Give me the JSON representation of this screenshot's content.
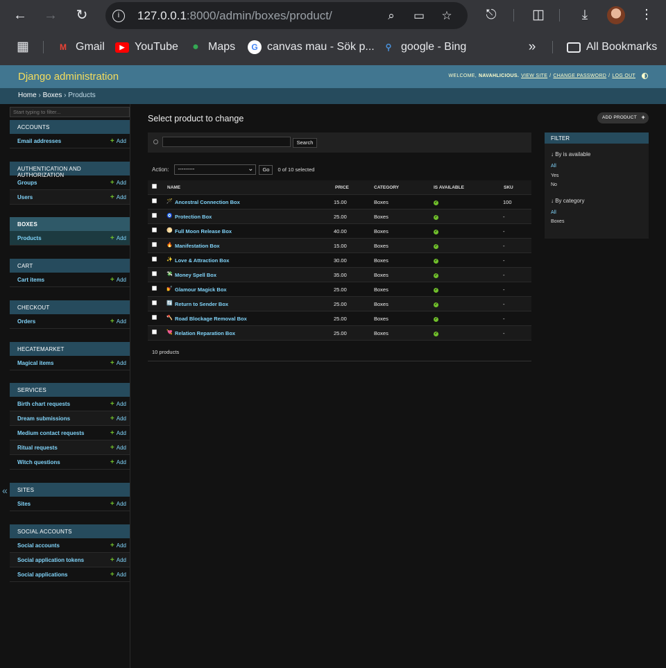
{
  "browser": {
    "url_host": "127.0.0.1",
    "url_path": ":8000/admin/boxes/product/",
    "bookmarks": [
      {
        "label": "Gmail",
        "icon": "gmail-icon"
      },
      {
        "label": "YouTube",
        "icon": "youtube-icon"
      },
      {
        "label": "Maps",
        "icon": "maps-icon"
      },
      {
        "label": "canvas mau - Sök p...",
        "icon": "google-icon"
      },
      {
        "label": "google - Bing",
        "icon": "bing-search-icon"
      }
    ],
    "all_bookmarks": "All Bookmarks"
  },
  "admin": {
    "brand": "Django administration",
    "welcome": "Welcome,",
    "username": "navahlicious.",
    "view_site": "View site",
    "change_password": "Change password",
    "log_out": "Log out"
  },
  "breadcrumbs": [
    "Home",
    "Boxes",
    "Products"
  ],
  "sidebar": {
    "filter_placeholder": "Start typing to filter...",
    "add_label": "Add",
    "modules": [
      {
        "title": "Accounts",
        "items": [
          "Email addresses"
        ]
      },
      {
        "title": "Authentication and Authorization",
        "items": [
          "Groups",
          "Users"
        ]
      },
      {
        "title": "Boxes",
        "items": [
          "Products"
        ]
      },
      {
        "title": "Cart",
        "items": [
          "Cart items"
        ]
      },
      {
        "title": "Checkout",
        "items": [
          "Orders"
        ]
      },
      {
        "title": "Hecatemarket",
        "items": [
          "Magical items"
        ]
      },
      {
        "title": "Services",
        "items": [
          "Birth chart requests",
          "Dream submissions",
          "Medium contact requests",
          "Ritual requests",
          "Witch questions"
        ]
      },
      {
        "title": "Sites",
        "items": [
          "Sites"
        ]
      },
      {
        "title": "Social Accounts",
        "items": [
          "Social accounts",
          "Social application tokens",
          "Social applications"
        ]
      }
    ]
  },
  "page": {
    "title": "Select product to change",
    "add_button": "Add product",
    "search_button": "Search",
    "action_label": "Action:",
    "action_value": "---------",
    "go_button": "Go",
    "selected_count": "0 of 10 selected",
    "footer_count": "10 products"
  },
  "table": {
    "columns": [
      "Name",
      "Price",
      "Category",
      "Is available",
      "SKU"
    ],
    "rows": [
      {
        "emoji": "🪄",
        "name": "Ancestral Connection Box",
        "price": "15.00",
        "category": "Boxes",
        "sku": "100"
      },
      {
        "emoji": "🧿",
        "name": "Protection Box",
        "price": "25.00",
        "category": "Boxes",
        "sku": "-"
      },
      {
        "emoji": "🌕",
        "name": "Full Moon Release Box",
        "price": "40.00",
        "category": "Boxes",
        "sku": "-"
      },
      {
        "emoji": "🔥",
        "name": "Manifestation Box",
        "price": "15.00",
        "category": "Boxes",
        "sku": "-"
      },
      {
        "emoji": "✨",
        "name": "Love & Attraction Box",
        "price": "30.00",
        "category": "Boxes",
        "sku": "-"
      },
      {
        "emoji": "💸",
        "name": "Money Spell Box",
        "price": "35.00",
        "category": "Boxes",
        "sku": "-"
      },
      {
        "emoji": "💅",
        "name": "Glamour Magick Box",
        "price": "25.00",
        "category": "Boxes",
        "sku": "-"
      },
      {
        "emoji": "🔄",
        "name": "Return to Sender Box",
        "price": "25.00",
        "category": "Boxes",
        "sku": "-"
      },
      {
        "emoji": "🪓",
        "name": "Road Blockage Removal Box",
        "price": "25.00",
        "category": "Boxes",
        "sku": "-"
      },
      {
        "emoji": "💘",
        "name": "Relation Reparation Box",
        "price": "25.00",
        "category": "Boxes",
        "sku": "-"
      }
    ]
  },
  "filter": {
    "title": "Filter",
    "groups": [
      {
        "title": "↓ By is available",
        "options": [
          "All",
          "Yes",
          "No"
        ]
      },
      {
        "title": "↓ By category",
        "options": [
          "All",
          "Boxes"
        ]
      }
    ]
  },
  "colors": {
    "accent": "#417690",
    "link": "#81d4fa",
    "brand": "#f5dd5d",
    "success": "#70bf2b"
  }
}
